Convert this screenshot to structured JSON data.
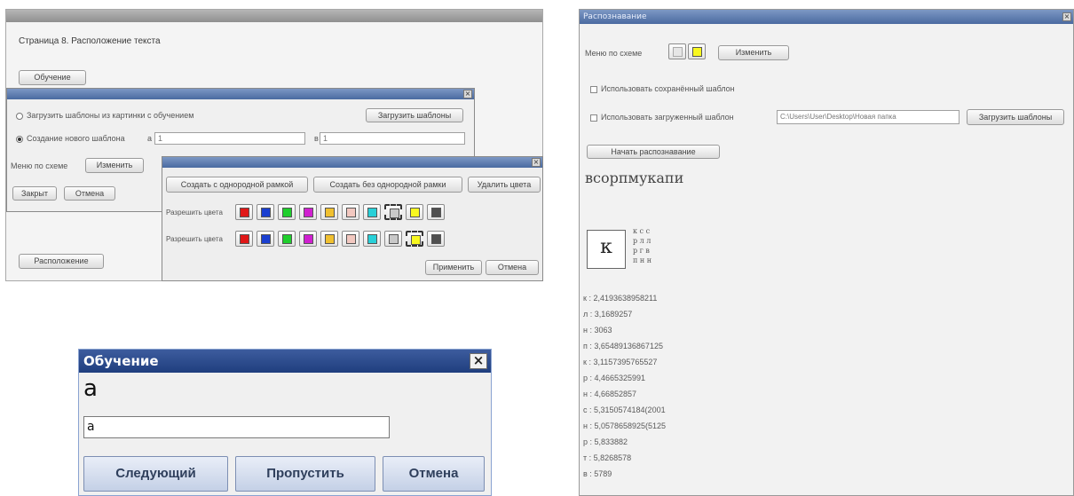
{
  "page_settings": {
    "title": "Страница 8. Расположение текста",
    "training_button": "Обучение",
    "layout_button": "Расположение"
  },
  "dialog": {
    "load_option": "Загрузить шаблоны из картинки с обучением",
    "load_button": "Загрузить шаблоны",
    "create_option": "Создание нового шаблона",
    "field_a_label": "а",
    "field_a_value": "1",
    "field_b_label": "в",
    "field_b_value": "1",
    "noise_label": "Меню по схеме",
    "change_button": "Изменить",
    "ok_button": "Закрыт",
    "cancel_button": "Отмена"
  },
  "color_picker": {
    "tab1": "Создать с однородной рамкой",
    "tab2": "Создать без однородной рамки",
    "tab3": "Удалить цвета",
    "row1_label": "Разрешить цвета",
    "row2_label": "Разрешить цвета",
    "apply_button": "Применить",
    "cancel_button": "Отмена",
    "colors_row1": [
      "#e01818",
      "#1a3fd0",
      "#1fce2c",
      "#d020d0",
      "#f0c030",
      "#f2c8c0",
      "#28d0d8",
      "#c8c8c8",
      "#f8f820",
      "#505050"
    ],
    "colors_row2": [
      "#e01818",
      "#1a3fd0",
      "#1fce2c",
      "#d020d0",
      "#f0c030",
      "#f2c8c0",
      "#28d0d8",
      "#c8c8c8",
      "#f8f820",
      "#505050"
    ]
  },
  "training_dialog": {
    "title": "Обучение",
    "prompt_char": "а",
    "input_value": "а",
    "next_button": "Следующий",
    "skip_button": "Пропустить",
    "cancel_button": "Отмена"
  },
  "recognition": {
    "title": "Распознавание",
    "mode_label": "Меню по схеме",
    "change_button": "Изменить",
    "option_saved": "Использовать сохранённый шаблон",
    "option_file": "Использовать загруженный шаблон",
    "file_path": "C:\\Users\\User\\Desktop\\Новая папка",
    "browse_button": "Загрузить шаблоны",
    "start_button": "Начать распознавание",
    "result_text": "всорпмукапи",
    "glyph": "к",
    "glyph_candidates": [
      "к с с",
      "р л л",
      "р г в",
      "п н н"
    ],
    "scores": [
      "к : 2,4193638958211",
      "л : 3,1689257",
      "н : 3063",
      "п : 3,65489136867125",
      "к : 3,1157395765527",
      "р : 4,4665325991",
      "н : 4,66852857",
      "с : 5,3150574184(2001",
      "н : 5,0578658925(5125",
      "р : 5,833882",
      "т : 5,8268578",
      "в : 5789"
    ]
  }
}
